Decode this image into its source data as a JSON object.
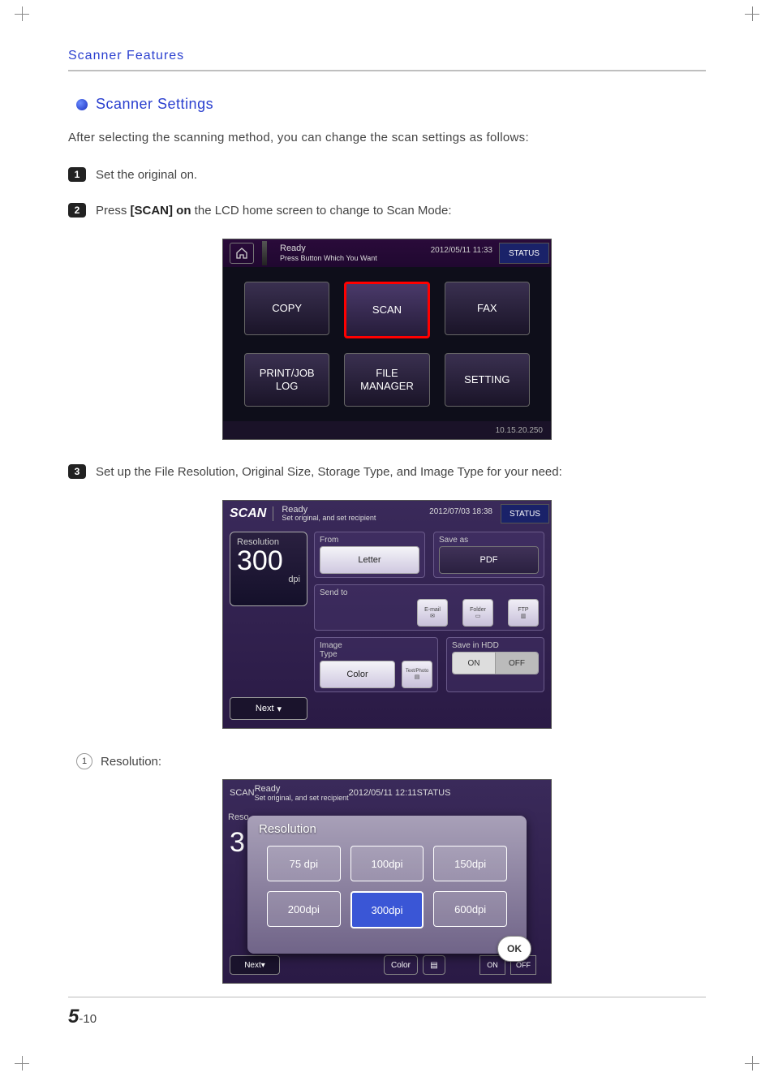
{
  "header": {
    "section": "Scanner Features"
  },
  "title": {
    "text": "Scanner Settings"
  },
  "intro": "After selecting the scanning method, you can change the scan settings as follows:",
  "steps": {
    "s1": {
      "num": "1",
      "text": "Set the original on."
    },
    "s2": {
      "num": "2",
      "pre": "Press ",
      "bold": "[SCAN] on",
      "post": " the LCD home screen to change to Scan Mode:"
    },
    "s3": {
      "num": "3",
      "text": "Set up the File Resolution, Original Size, Storage Type, and Image Type for your need:"
    }
  },
  "lcd1": {
    "ready": "Ready",
    "sub": "Press Button Which You Want",
    "time": "2012/05/11 11:33",
    "status": "STATUS",
    "tiles": {
      "copy": "COPY",
      "scan": "SCAN",
      "fax": "FAX",
      "print": "PRINT/JOB\nLOG",
      "file": "FILE\nMANAGER",
      "setting": "SETTING"
    },
    "ip": "10.15.20.250"
  },
  "lcd2": {
    "title": "SCAN",
    "ready": "Ready",
    "sub": "Set original, and set recipient",
    "time": "2012/07/03 18:38",
    "status": "STATUS",
    "res": {
      "label": "Resolution",
      "value": "300",
      "unit": "dpi"
    },
    "next": "Next",
    "from": {
      "label": "From",
      "value": "Letter"
    },
    "saveas": {
      "label": "Save as",
      "value": "PDF"
    },
    "sendto": {
      "label": "Send to",
      "email": "E-mail",
      "folder": "Folder",
      "ftp": "FTP"
    },
    "imgtype": {
      "label": "Image\nType",
      "color": "Color",
      "tp": "Text/Photo"
    },
    "hdd": {
      "label": "Save in HDD",
      "on": "ON",
      "off": "OFF"
    }
  },
  "sub1": {
    "num": "1",
    "text": "Resolution:"
  },
  "lcd3": {
    "title": "SCAN",
    "ready": "Ready",
    "sub": "Set original, and set recipient",
    "time": "2012/05/11 12:11",
    "status": "STATUS",
    "bgres": "Reso",
    "bgval": "3",
    "modal_title": "Resolution",
    "opts": [
      "75 dpi",
      "100dpi",
      "150dpi",
      "200dpi",
      "300dpi",
      "600dpi"
    ],
    "selected": 4,
    "ok": "OK",
    "next": "Next",
    "color": "Color",
    "on": "ON",
    "off": "OFF"
  },
  "footer": {
    "chapter": "5",
    "sep": "-",
    "page": "10"
  }
}
